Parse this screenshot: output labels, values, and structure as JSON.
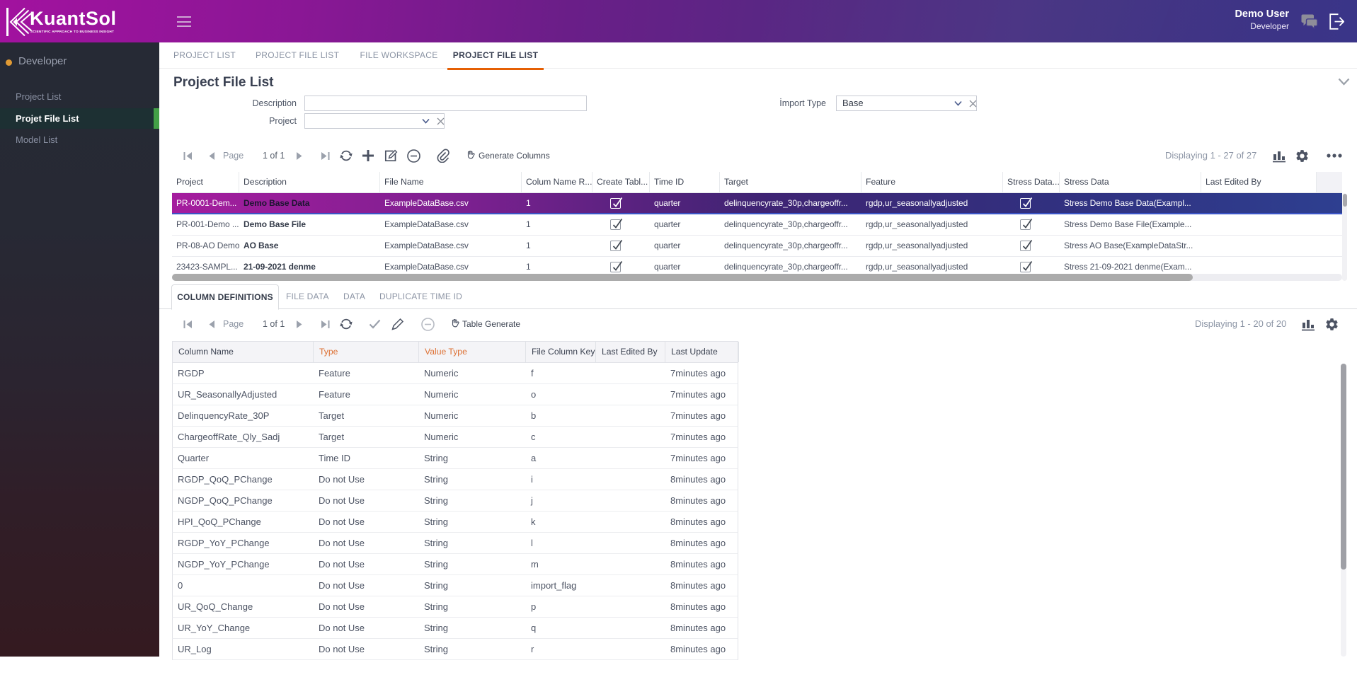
{
  "topbar": {
    "logo_text": "KuantSol",
    "logo_tagline": "SCIENTIFIC APPROACH TO BUSINESS INSIGHT",
    "user_name": "Demo User",
    "user_role": "Developer"
  },
  "sidebar": {
    "section_label": "Developer",
    "items": [
      {
        "label": "Project List",
        "active": false
      },
      {
        "label": "Projet File List",
        "active": true
      },
      {
        "label": "Model List",
        "active": false
      }
    ]
  },
  "tabs": [
    {
      "label": "PROJECT LIST",
      "active": false
    },
    {
      "label": "PROJECT FILE LIST",
      "active": false
    },
    {
      "label": "FILE WORKSPACE",
      "active": false
    },
    {
      "label": "PROJECT FILE LIST",
      "active": true
    }
  ],
  "page": {
    "title": "Project File List"
  },
  "filters": {
    "description_label": "Description",
    "description_value": "",
    "project_label": "Project",
    "project_value": "",
    "import_type_label": "İmport Type",
    "import_type_value": "Base"
  },
  "toolbar_top": {
    "page_label": "Page",
    "page_value": "1 of 1",
    "action_label": "Generate Columns",
    "displaying": "Displaying 1 - 27 of 27"
  },
  "grid_top": {
    "columns": [
      "Project",
      "Description",
      "File Name",
      "Colum Name R...",
      "Create Tabl...",
      "Time ID",
      "Target",
      "Feature",
      "Stress Data...",
      "Stress Data",
      "Last Edited By"
    ],
    "rows": [
      {
        "selected": true,
        "cells": [
          "PR-0001-Dem...",
          "Demo Base Data",
          "ExampleDataBase.csv",
          "1",
          true,
          "quarter",
          "delinquencyrate_30p,chargeoffr...",
          "rgdp,ur_seasonallyadjusted",
          true,
          "Stress Demo Base Data(Exampl...",
          ""
        ]
      },
      {
        "selected": false,
        "cells": [
          "PR-001-Demo ...",
          "Demo Base File",
          "ExampleDataBase.csv",
          "1",
          true,
          "quarter",
          "delinquencyrate_30p,chargeoffr...",
          "rgdp,ur_seasonallyadjusted",
          true,
          "Stress Demo Base File(Example...",
          ""
        ]
      },
      {
        "selected": false,
        "cells": [
          "PR-08-AO Demo",
          "AO Base",
          "ExampleDataBase.csv",
          "1",
          true,
          "quarter",
          "delinquencyrate_30p,chargeoffr...",
          "rgdp,ur_seasonallyadjusted",
          true,
          "Stress AO Base(ExampleDataStr...",
          ""
        ]
      },
      {
        "selected": false,
        "cells": [
          "23423-SAMPL...",
          "21-09-2021 denme",
          "ExampleDataBase.csv",
          "1",
          true,
          "quarter",
          "delinquencyrate_30p,chargeoffr...",
          "rgdp,ur_seasonallyadjusted",
          true,
          "Stress 21-09-2021 denme(Exam...",
          ""
        ]
      }
    ]
  },
  "subtabs": [
    {
      "label": "COLUMN DEFINITIONS",
      "active": true
    },
    {
      "label": "FILE DATA",
      "active": false
    },
    {
      "label": "DATA",
      "active": false
    },
    {
      "label": "DUPLICATE TIME ID",
      "active": false
    }
  ],
  "toolbar_bottom": {
    "page_label": "Page",
    "page_value": "1 of 1",
    "action_label": "Table Generate",
    "displaying": "Displaying 1 - 20 of 20"
  },
  "grid_bottom": {
    "columns": [
      "Column Name",
      "Type",
      "Value Type",
      "File Column Key",
      "Last Edited By",
      "Last Update"
    ],
    "rows": [
      [
        "RGDP",
        "Feature",
        "Numeric",
        "f",
        "",
        "7minutes ago"
      ],
      [
        "UR_SeasonallyAdjusted",
        "Feature",
        "Numeric",
        "o",
        "",
        "7minutes ago"
      ],
      [
        "DelinquencyRate_30P",
        "Target",
        "Numeric",
        "b",
        "",
        "7minutes ago"
      ],
      [
        "ChargeoffRate_Qly_Sadj",
        "Target",
        "Numeric",
        "c",
        "",
        "7minutes ago"
      ],
      [
        "Quarter",
        "Time ID",
        "String",
        "a",
        "",
        "7minutes ago"
      ],
      [
        "RGDP_QoQ_PChange",
        "Do not Use",
        "String",
        "i",
        "",
        "8minutes ago"
      ],
      [
        "NGDP_QoQ_PChange",
        "Do not Use",
        "String",
        "j",
        "",
        "8minutes ago"
      ],
      [
        "HPI_QoQ_PChange",
        "Do not Use",
        "String",
        "k",
        "",
        "8minutes ago"
      ],
      [
        "RGDP_YoY_PChange",
        "Do not Use",
        "String",
        "l",
        "",
        "8minutes ago"
      ],
      [
        "NGDP_YoY_PChange",
        "Do not Use",
        "String",
        "m",
        "",
        "8minutes ago"
      ],
      [
        "0",
        "Do not Use",
        "String",
        "import_flag",
        "",
        "8minutes ago"
      ],
      [
        "UR_QoQ_Change",
        "Do not Use",
        "String",
        "p",
        "",
        "8minutes ago"
      ],
      [
        "UR_YoY_Change",
        "Do not Use",
        "String",
        "q",
        "",
        "8minutes ago"
      ],
      [
        "UR_Log",
        "Do not Use",
        "String",
        "r",
        "",
        "8minutes ago"
      ]
    ]
  }
}
